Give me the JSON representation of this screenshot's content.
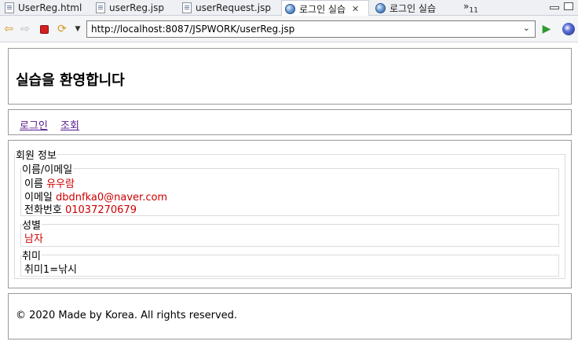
{
  "tabs": [
    {
      "label": "UserReg.html",
      "icon": "file-icon",
      "active": false
    },
    {
      "label": "userReg.jsp",
      "icon": "file-icon",
      "active": false
    },
    {
      "label": "userRequest.jsp",
      "icon": "file-icon",
      "active": false
    },
    {
      "label": "로그인 실습",
      "icon": "globe-icon",
      "active": true
    },
    {
      "label": "로그인 실습",
      "icon": "globe-icon",
      "active": false
    }
  ],
  "tab_overflow": {
    "chevron": "»",
    "count": "11"
  },
  "toolbar": {
    "url": "http://localhost:8087/JSPWORK/userReg.jsp",
    "back_icon": "back-arrow-icon",
    "forward_icon": "forward-arrow-icon",
    "stop_icon": "stop-icon",
    "refresh_icon": "refresh-icon",
    "go_icon": "go-icon"
  },
  "page": {
    "title": "실습을 환영합니다",
    "nav": {
      "login": "로그인",
      "search": "조회"
    },
    "member": {
      "legend": "회원 정보",
      "name_email": {
        "legend": "이름/이메일",
        "name_label": "이름",
        "name_value": "유우람",
        "email_label": "이메일",
        "email_value": "dbdnfka0@naver.com",
        "phone_label": "전화번호",
        "phone_value": "01037270679"
      },
      "gender": {
        "legend": "성별",
        "value": "남자"
      },
      "hobby": {
        "legend": "취미",
        "value": "취미1=낚시"
      }
    },
    "footer": "© 2020 Made by Korea. All rights reserved."
  },
  "colors": {
    "value_text": "#cc0000",
    "visited_link": "#551a8b"
  }
}
